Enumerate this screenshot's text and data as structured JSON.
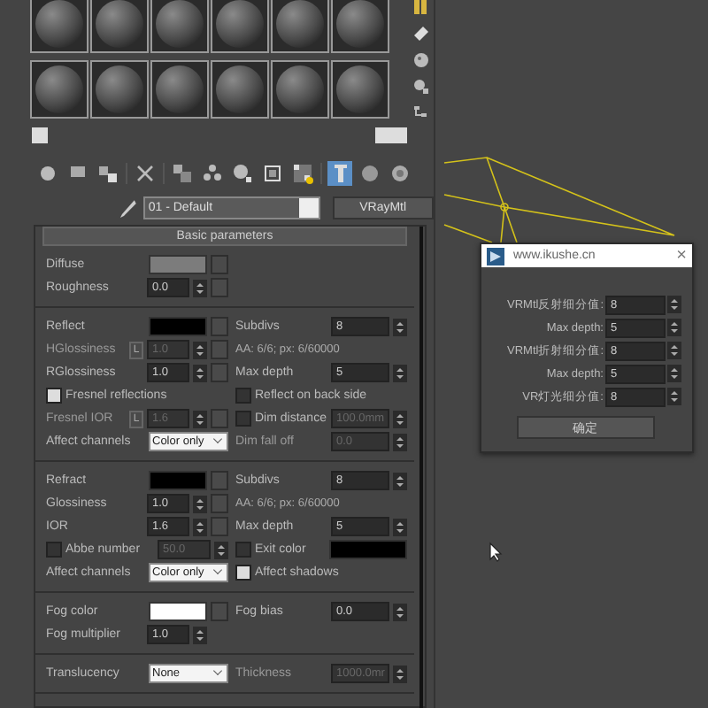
{
  "toolbar": [
    {
      "selected": false
    },
    {
      "selected": false
    },
    {
      "selected": false
    },
    {
      "selected": false
    },
    {
      "selected": false
    },
    {
      "selected": false
    },
    {
      "selected": false
    },
    {
      "selected": false
    },
    {
      "selected": false
    },
    {
      "selected": true
    },
    {
      "selected": false
    },
    {
      "selected": false
    }
  ],
  "material": {
    "name": "01 - Default",
    "type": "VRayMtl"
  },
  "rollout": {
    "title": "Basic parameters",
    "sections": [
      {
        "rows": [
          {
            "left": {
              "kind": "color",
              "label": "Diffuse",
              "color": "#7c7c7c",
              "map": true
            }
          },
          {
            "left": {
              "kind": "spinner",
              "label": "Roughness",
              "value": "0.0",
              "map": true
            }
          }
        ]
      },
      {
        "rows": [
          {
            "left": {
              "kind": "color",
              "label": "Reflect",
              "color": "#000000",
              "map": true
            },
            "right": {
              "kind": "spinner",
              "label": "Subdivs",
              "value": "8"
            }
          },
          {
            "left": {
              "kind": "spinner",
              "label": "HGlossiness",
              "value": "1.0",
              "lock": "L",
              "map": true,
              "disabled": true
            },
            "right": {
              "kind": "note",
              "label": "AA: 6/6; px: 6/60000"
            }
          },
          {
            "left": {
              "kind": "spinner",
              "label": "RGlossiness",
              "value": "1.0",
              "map": true
            },
            "right": {
              "kind": "spinner",
              "label": "Max depth",
              "value": "5"
            }
          },
          {
            "left": {
              "kind": "checkbox",
              "label": "Fresnel reflections",
              "checked": true
            },
            "right": {
              "kind": "checkbox",
              "label": "Reflect on back side",
              "checked": false
            }
          },
          {
            "left": {
              "kind": "spinner",
              "label": "Fresnel IOR",
              "value": "1.6",
              "lock": "L",
              "map": true,
              "disabled": true
            },
            "right": {
              "kind": "checkbox",
              "label": "Dim distance",
              "checked": false,
              "value": "100.0mm"
            }
          },
          {
            "left": {
              "kind": "dropdown",
              "label": "Affect channels",
              "value": "Color only"
            },
            "right": {
              "kind": "spinner",
              "label": "Dim fall off",
              "value": "0.0",
              "disabled": true
            }
          }
        ]
      },
      {
        "rows": [
          {
            "left": {
              "kind": "color",
              "label": "Refract",
              "color": "#000000",
              "map": true
            },
            "right": {
              "kind": "spinner",
              "label": "Subdivs",
              "value": "8"
            }
          },
          {
            "left": {
              "kind": "spinner",
              "label": "Glossiness",
              "value": "1.0",
              "map": true
            },
            "right": {
              "kind": "note",
              "label": "AA: 6/6; px: 6/60000"
            }
          },
          {
            "left": {
              "kind": "spinner",
              "label": "IOR",
              "value": "1.6",
              "map": true
            },
            "right": {
              "kind": "spinner",
              "label": "Max depth",
              "value": "5"
            }
          },
          {
            "left": {
              "kind": "checkbox",
              "label": "Abbe number",
              "checked": false,
              "value": "50.0"
            },
            "right": {
              "kind": "checkbox",
              "label": "Exit color",
              "checked": false,
              "color": "#000000"
            }
          },
          {
            "left": {
              "kind": "dropdown",
              "label": "Affect channels",
              "value": "Color only"
            },
            "right": {
              "kind": "checkbox",
              "label": "Affect shadows",
              "checked": true
            }
          }
        ]
      },
      {
        "rows": [
          {
            "left": {
              "kind": "color",
              "label": "Fog color",
              "color": "#ffffff",
              "map": true
            },
            "right": {
              "kind": "spinner",
              "label": "Fog bias",
              "value": "0.0"
            }
          },
          {
            "left": {
              "kind": "spinner",
              "label": "Fog multiplier",
              "value": "1.0"
            }
          }
        ]
      },
      {
        "rows": [
          {
            "left": {
              "kind": "dropdown",
              "label": "Translucency",
              "value": "None"
            },
            "right": {
              "kind": "spinner",
              "label": "Thickness",
              "value": "1000.0mr",
              "disabled": true
            }
          }
        ]
      }
    ]
  },
  "dialog": {
    "title": "www.ikushe.cn",
    "close": "×",
    "rows": [
      {
        "label": "VRMtl反射细分值:",
        "value": "8"
      },
      {
        "label": "Max depth:",
        "value": "5"
      },
      {
        "label": "VRMtl折射细分值:",
        "value": "8"
      },
      {
        "label": "Max depth:",
        "value": "5"
      },
      {
        "label": "VR灯光细分值:",
        "value": "8"
      }
    ],
    "button": "确定"
  }
}
